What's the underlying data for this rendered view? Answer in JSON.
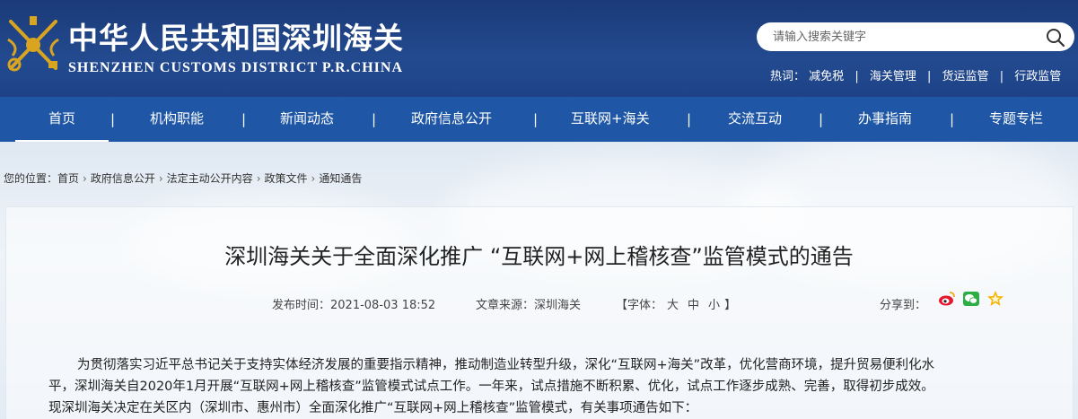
{
  "header": {
    "title_cn": "中华人民共和国深圳海关",
    "title_en": "SHENZHEN CUSTOMS DISTRICT P.R.CHINA",
    "search": {
      "placeholder": "请输入搜索关键字"
    },
    "hot": {
      "label": "热词：",
      "items": [
        "减免税",
        "海关管理",
        "货运监管",
        "行政监管"
      ],
      "separator": "|"
    }
  },
  "nav": {
    "items": [
      "首页",
      "机构职能",
      "新闻动态",
      "政府信息公开",
      "互联网+海关",
      "交流互动",
      "办事指南",
      "专题专栏"
    ],
    "separator": "|"
  },
  "breadcrumb": {
    "label": "您的位置：",
    "items": [
      "首页",
      "政府信息公开",
      "法定主动公开内容",
      "政策文件",
      "通知通告"
    ],
    "arrow": "›"
  },
  "article": {
    "title": "深圳海关关于全面深化推广 “互联网+网上稽核查”监管模式的通告",
    "publish_label": "发布时间：",
    "publish_time": "2021-08-03 18:52",
    "source_label": "文章来源：",
    "source": "深圳海关",
    "font_open": "【字体：",
    "font_sizes": [
      "大",
      "中",
      "小"
    ],
    "font_close": "】",
    "share_label": "分享到：",
    "paragraph_lines": [
      "为贯彻落实习近平总书记关于支持实体经济发展的重要指示精神，推动制造业转型升级，深化“互联网+海关”改革，优化营商环境，提升贸易便利化水",
      "平，深圳海关自2020年1月开展“互联网+网上稽核查”监管模式试点工作。一年来，试点措施不断积累、优化，试点工作逐步成熟、完善，取得初步成效。",
      "现深圳海关决定在关区内（深圳市、惠州市）全面深化推广“互联网+网上稽核查”监管模式，有关事项通告如下："
    ]
  },
  "colors": {
    "header_bg": "#1b3a78",
    "nav_bg": "#1f57a6",
    "emblem_gold": "#d9a520"
  },
  "icons": [
    "customs-emblem-icon",
    "search-icon",
    "weibo-icon",
    "wechat-icon",
    "favorite-star-icon"
  ]
}
